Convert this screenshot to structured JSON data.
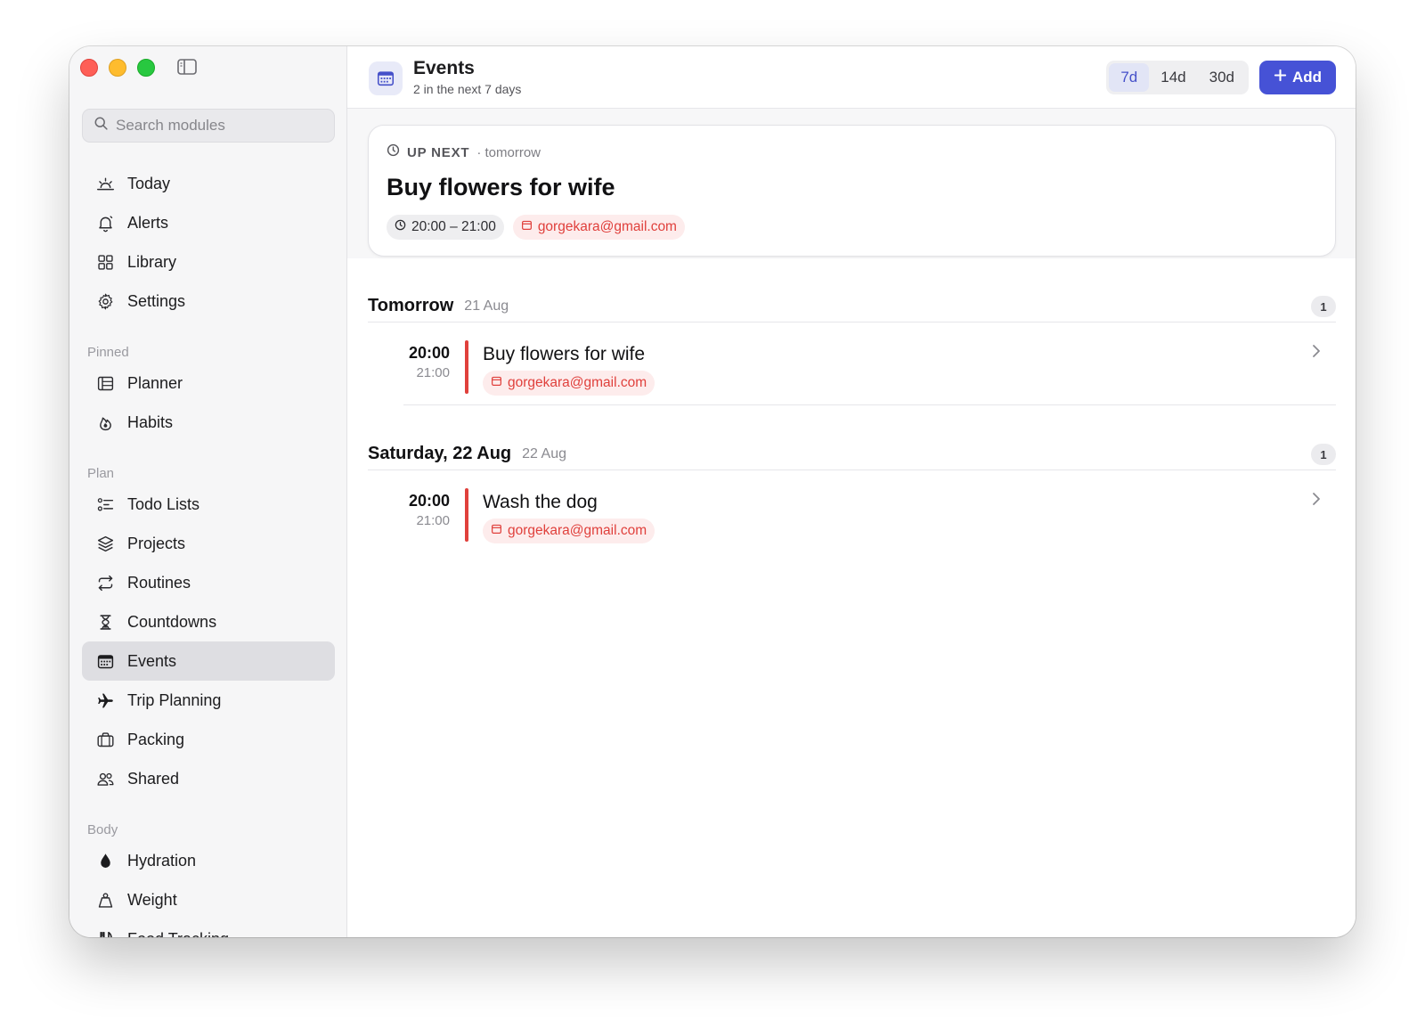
{
  "window": {
    "title": "Events"
  },
  "sidebar": {
    "search_placeholder": "Search modules",
    "top_items": [
      {
        "label": "Today",
        "icon": "sunrise-icon"
      },
      {
        "label": "Alerts",
        "icon": "bell-icon"
      },
      {
        "label": "Library",
        "icon": "grid-icon"
      },
      {
        "label": "Settings",
        "icon": "gear-icon"
      }
    ],
    "sections": [
      {
        "label": "Pinned",
        "items": [
          {
            "label": "Planner",
            "icon": "planner-icon"
          },
          {
            "label": "Habits",
            "icon": "flame-icon"
          }
        ]
      },
      {
        "label": "Plan",
        "items": [
          {
            "label": "Todo Lists",
            "icon": "checklist-icon"
          },
          {
            "label": "Projects",
            "icon": "layers-icon"
          },
          {
            "label": "Routines",
            "icon": "repeat-icon"
          },
          {
            "label": "Countdowns",
            "icon": "hourglass-icon"
          },
          {
            "label": "Events",
            "icon": "calendar-icon",
            "active": true
          },
          {
            "label": "Trip Planning",
            "icon": "airplane-icon"
          },
          {
            "label": "Packing",
            "icon": "suitcase-icon"
          },
          {
            "label": "Shared",
            "icon": "people-icon"
          }
        ]
      },
      {
        "label": "Body",
        "items": [
          {
            "label": "Hydration",
            "icon": "drop-icon"
          },
          {
            "label": "Weight",
            "icon": "weight-icon"
          },
          {
            "label": "Food Tracking",
            "icon": "fork-knife-icon"
          }
        ]
      }
    ]
  },
  "header": {
    "title": "Events",
    "subtitle": "2 in the next 7 days",
    "ranges": [
      "7d",
      "14d",
      "30d"
    ],
    "active_range": "7d",
    "add_label": "Add"
  },
  "up_next": {
    "label": "UP NEXT",
    "when": "· tomorrow",
    "title": "Buy flowers for wife",
    "time": "20:00 – 21:00",
    "calendar": "gorgekara@gmail.com"
  },
  "days": [
    {
      "title": "Tomorrow",
      "date": "21 Aug",
      "count": "1",
      "events": [
        {
          "start": "20:00",
          "end": "21:00",
          "title": "Buy flowers for wife",
          "calendar": "gorgekara@gmail.com"
        }
      ]
    },
    {
      "title": "Saturday, 22 Aug",
      "date": "22 Aug",
      "count": "1",
      "events": [
        {
          "start": "20:00",
          "end": "21:00",
          "title": "Wash the dog",
          "calendar": "gorgekara@gmail.com"
        }
      ]
    }
  ],
  "colors": {
    "accent": "#4652d6",
    "calendar_red": "#e0403c",
    "active_nav": "#dedee2"
  }
}
